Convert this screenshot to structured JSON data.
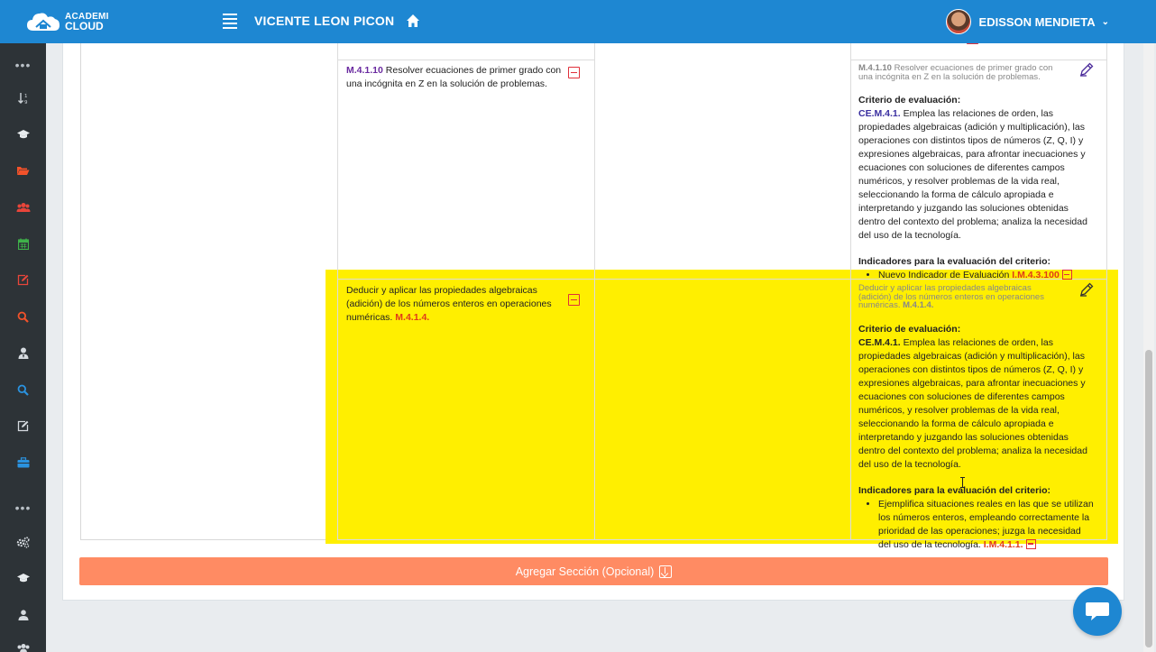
{
  "header": {
    "logo_line1": "ACADEMI",
    "logo_line2": "CLOUD",
    "title": "VICENTE LEON PICON",
    "user_name": "EDISSON MENDIETA"
  },
  "sidebar": {
    "icons": [
      "more-dots-icon",
      "sort-icon",
      "graduation-cap-icon",
      "folder-open-icon",
      "users-icon",
      "calendar-icon",
      "edit-icon",
      "search-icon",
      "user-tie-icon",
      "search-icon",
      "edit-icon",
      "briefcase-icon",
      "more-dots-icon",
      "cogs-icon",
      "graduation-cap-icon",
      "user-icon",
      "users-icon"
    ]
  },
  "rows": [
    {
      "left_code": "M.4.1.10",
      "left_text": " Resolver ecuaciones de primer grado con una incógnita en Z en la solución de problemas.",
      "right_head_code": "M.4.1.10",
      "right_head_text": " Resolver ecuaciones de primer grado con una incógnita en Z en la solución de problemas.",
      "criterio_label": "Criterio de evaluación:",
      "criterio_code": "CE.M.4.1.",
      "criterio_text": " Emplea las relaciones de orden, las propiedades algebraicas (adición y multiplicación), las operaciones con distintos tipos de números (Z, Q, I) y expresiones algebraicas, para afrontar inecuaciones y ecuaciones con soluciones de diferentes campos numéricos, y resolver problemas de la vida real, seleccionando la forma de cálculo apropiada e interpretando y juzgando las soluciones obtenidas dentro del contexto del problema; analiza la necesidad del uso de la tecnología.",
      "indicadores_label": "Indicadores para la evaluación del criterio:",
      "indicador_text": "Nuevo Indicador de Evaluación ",
      "indicador_code": "I.M.4.3.100"
    },
    {
      "left_text": "Deducir y aplicar las propiedades algebraicas (adición) de los números enteros en operaciones numéricas. ",
      "left_code": "M.4.1.4.",
      "right_head_text": "Deducir y aplicar las propiedades algebraicas (adición) de los números enteros en operaciones numéricas. ",
      "right_head_code": "M.4.1.4.",
      "criterio_label": "Criterio de evaluación:",
      "criterio_code": "CE.M.4.1.",
      "criterio_text": " Emplea las relaciones de orden, las propiedades algebraicas (adición y multiplicación), las operaciones con distintos tipos de números (Z, Q, I) y expresiones algebraicas, para afrontar inecuaciones y ecuaciones con soluciones de diferentes campos numéricos, y resolver problemas de la vida real, seleccionando la forma de cálculo apropiada e interpretando y juzgando las soluciones obtenidas dentro del contexto del problema; analiza la necesidad del uso de la tecnología.",
      "indicadores_label": "Indicadores para la evaluación del criterio:",
      "indicador_text": "Ejemplifica situaciones reales en las que se utilizan los números enteros, empleando correctamente la prioridad de las operaciones; juzga la necesidad del uso de la tecnología. ",
      "indicador_code": "I.M.4.1.1."
    }
  ],
  "add_button_label": "Agregar Sección (Opcional)",
  "colors": {
    "topbar": "#1e87d2",
    "sidebar": "#2d3337",
    "highlight": "#ffef00",
    "add_button": "#ff8b63",
    "remove_red": "#e0303a"
  }
}
